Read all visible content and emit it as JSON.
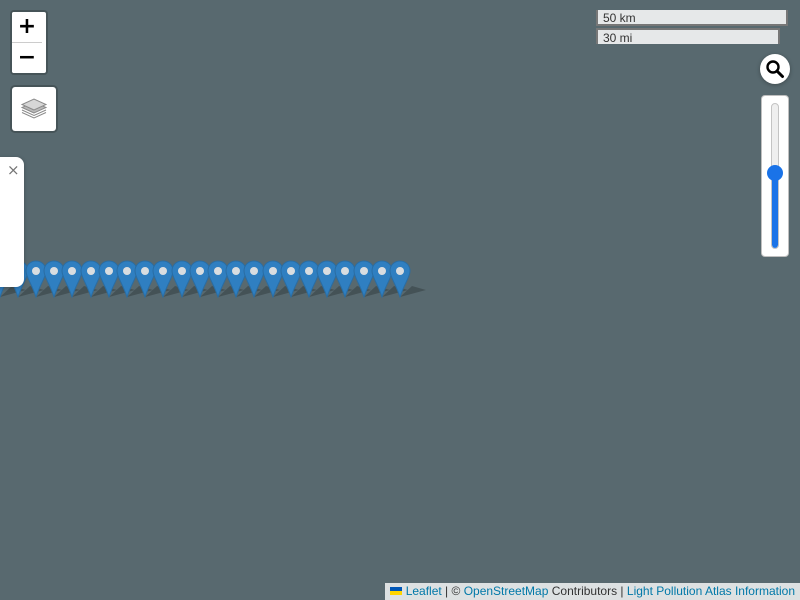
{
  "map": {
    "zoom_in_label": "+",
    "zoom_out_label": "−",
    "layers_icon": "layers-icon",
    "search_icon": "search-icon",
    "close_label": "×",
    "marker_count": 23,
    "colors": {
      "background": "#58696f",
      "marker": "#2f7fc1",
      "slider_accent": "#1a73e8"
    }
  },
  "scale": {
    "metric": "50 km",
    "imperial": "30 mi"
  },
  "slider": {
    "value_fraction": 0.52
  },
  "attribution": {
    "leaflet": "Leaflet",
    "sep1": " | © ",
    "osm": "OpenStreetMap",
    "contributors": " Contributors | ",
    "atlas": "Light Pollution Atlas Information"
  }
}
